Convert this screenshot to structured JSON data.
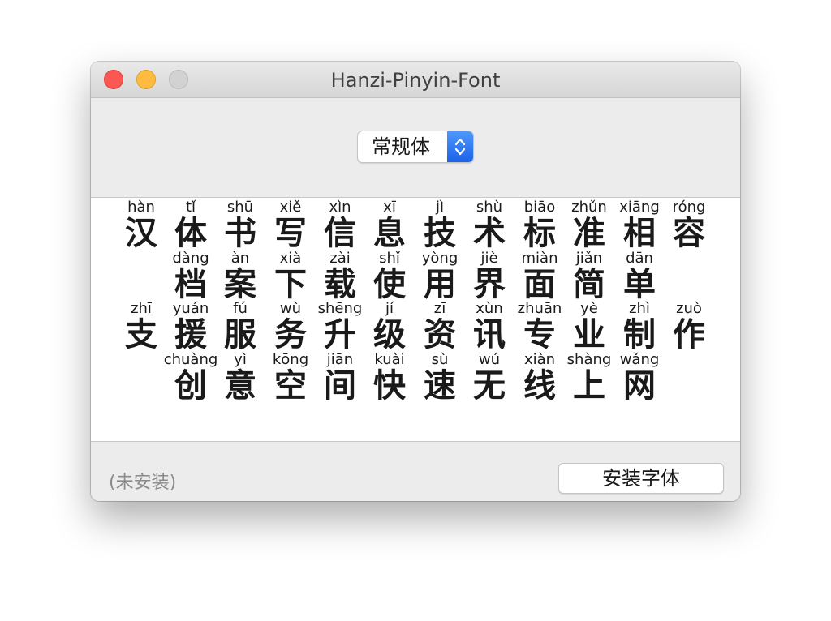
{
  "window": {
    "title": "Hanzi-Pinyin-Font"
  },
  "style_select": {
    "value": "常规体"
  },
  "sample": {
    "rows": [
      {
        "cells": [
          {
            "pinyin": "hàn",
            "hanzi": "汉"
          },
          {
            "pinyin": "tǐ",
            "hanzi": "体"
          },
          {
            "pinyin": "shū",
            "hanzi": "书"
          },
          {
            "pinyin": "xiě",
            "hanzi": "写"
          },
          {
            "pinyin": "xìn",
            "hanzi": "信"
          },
          {
            "pinyin": "xī",
            "hanzi": "息"
          },
          {
            "pinyin": "jì",
            "hanzi": "技"
          },
          {
            "pinyin": "shù",
            "hanzi": "术"
          },
          {
            "pinyin": "biāo",
            "hanzi": "标"
          },
          {
            "pinyin": "zhǔn",
            "hanzi": "准"
          },
          {
            "pinyin": "xiāng",
            "hanzi": "相"
          },
          {
            "pinyin": "róng",
            "hanzi": "容"
          }
        ]
      },
      {
        "cells": [
          {
            "pinyin": "dàng",
            "hanzi": "档"
          },
          {
            "pinyin": "àn",
            "hanzi": "案"
          },
          {
            "pinyin": "xià",
            "hanzi": "下"
          },
          {
            "pinyin": "zài",
            "hanzi": "载"
          },
          {
            "pinyin": "shǐ",
            "hanzi": "使"
          },
          {
            "pinyin": "yòng",
            "hanzi": "用"
          },
          {
            "pinyin": "jiè",
            "hanzi": "界"
          },
          {
            "pinyin": "miàn",
            "hanzi": "面"
          },
          {
            "pinyin": "jiǎn",
            "hanzi": "简"
          },
          {
            "pinyin": "dān",
            "hanzi": "单"
          }
        ]
      },
      {
        "cells": [
          {
            "pinyin": "zhī",
            "hanzi": "支"
          },
          {
            "pinyin": "yuán",
            "hanzi": "援"
          },
          {
            "pinyin": "fú",
            "hanzi": "服"
          },
          {
            "pinyin": "wù",
            "hanzi": "务"
          },
          {
            "pinyin": "shēng",
            "hanzi": "升"
          },
          {
            "pinyin": "jí",
            "hanzi": "级"
          },
          {
            "pinyin": "zī",
            "hanzi": "资"
          },
          {
            "pinyin": "xùn",
            "hanzi": "讯"
          },
          {
            "pinyin": "zhuān",
            "hanzi": "专"
          },
          {
            "pinyin": "yè",
            "hanzi": "业"
          },
          {
            "pinyin": "zhì",
            "hanzi": "制"
          },
          {
            "pinyin": "zuò",
            "hanzi": "作"
          }
        ]
      },
      {
        "cells": [
          {
            "pinyin": "chuàng",
            "hanzi": "创"
          },
          {
            "pinyin": "yì",
            "hanzi": "意"
          },
          {
            "pinyin": "kōng",
            "hanzi": "空"
          },
          {
            "pinyin": "jiān",
            "hanzi": "间"
          },
          {
            "pinyin": "kuài",
            "hanzi": "快"
          },
          {
            "pinyin": "sù",
            "hanzi": "速"
          },
          {
            "pinyin": "wú",
            "hanzi": "无"
          },
          {
            "pinyin": "xiàn",
            "hanzi": "线"
          },
          {
            "pinyin": "shàng",
            "hanzi": "上"
          },
          {
            "pinyin": "wǎng",
            "hanzi": "网"
          }
        ]
      }
    ]
  },
  "footer": {
    "status": "(未安装)",
    "install_label": "安装字体"
  }
}
